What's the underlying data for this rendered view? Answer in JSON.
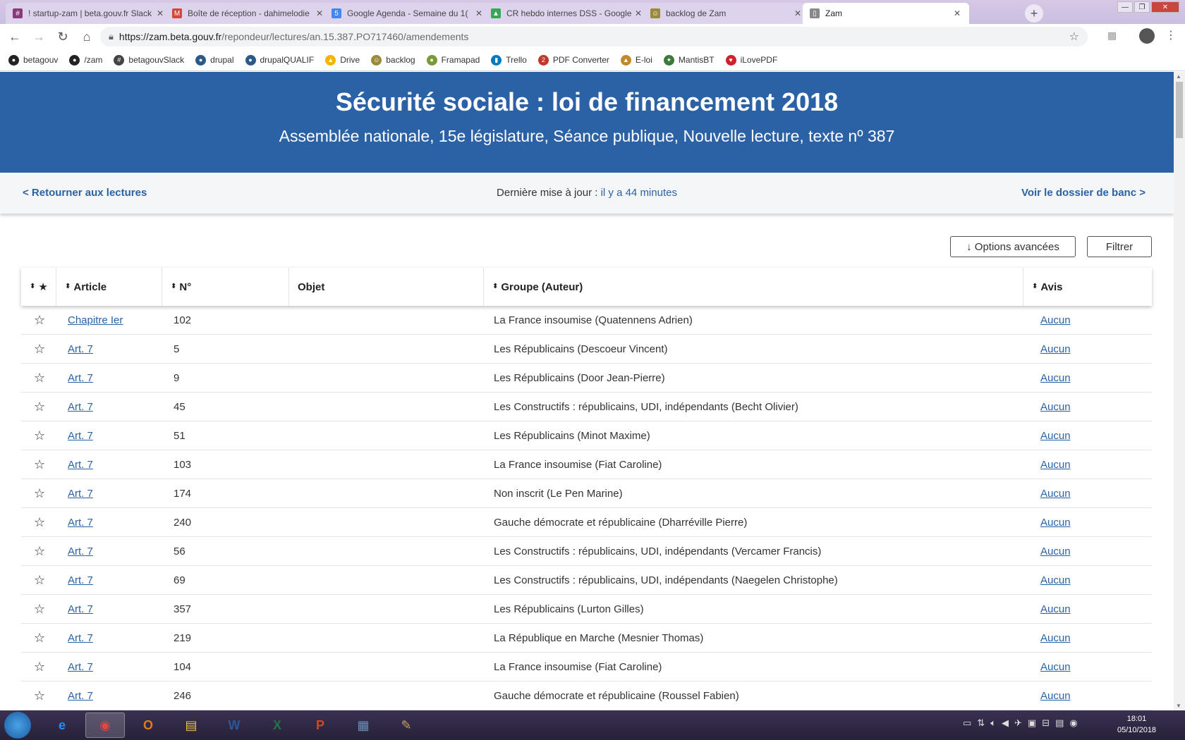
{
  "browser": {
    "tabs": [
      {
        "title": "! startup-zam | beta.gouv.fr Slack",
        "icon": "slack-icon",
        "color": "#8a3a7a",
        "glyph": "#"
      },
      {
        "title": "Boîte de réception - dahimelodie",
        "icon": "gmail-icon",
        "color": "#d44638",
        "glyph": "M"
      },
      {
        "title": "Google Agenda - Semaine du 1(",
        "icon": "calendar-icon",
        "color": "#4285f4",
        "glyph": "5"
      },
      {
        "title": "CR hebdo internes DSS - Google",
        "icon": "drive-icon",
        "color": "#34a853",
        "glyph": "▲"
      },
      {
        "title": "backlog de Zam",
        "icon": "framaboard-icon",
        "color": "#9a8a3a",
        "glyph": "☺"
      },
      {
        "title": "Zam",
        "icon": "page-icon",
        "color": "#888888",
        "glyph": "▯"
      }
    ],
    "url_host": "https://zam.beta.gouv.fr",
    "url_path": "/repondeur/lectures/an.15.387.PO717460/amendements",
    "bookmarks": [
      {
        "label": "betagouv",
        "color": "#222222",
        "glyph": "●"
      },
      {
        "label": "/zam",
        "color": "#222222",
        "glyph": "●"
      },
      {
        "label": "betagouvSlack",
        "color": "#444444",
        "glyph": "#"
      },
      {
        "label": "drupal",
        "color": "#2b5a8a",
        "glyph": "●"
      },
      {
        "label": "drupalQUALIF",
        "color": "#2b5a8a",
        "glyph": "●"
      },
      {
        "label": "Drive",
        "color": "#f4b400",
        "glyph": "▲"
      },
      {
        "label": "backlog",
        "color": "#9a8a3a",
        "glyph": "☺"
      },
      {
        "label": "Framapad",
        "color": "#7a9a3a",
        "glyph": "●"
      },
      {
        "label": "Trello",
        "color": "#0079bf",
        "glyph": "▮"
      },
      {
        "label": "PDF Converter",
        "color": "#c0392b",
        "glyph": "2"
      },
      {
        "label": "E-loi",
        "color": "#c08a2a",
        "glyph": "▲"
      },
      {
        "label": "MantisBT",
        "color": "#3a7a3a",
        "glyph": "✦"
      },
      {
        "label": "iLovePDF",
        "color": "#d0202a",
        "glyph": "♥"
      }
    ]
  },
  "page": {
    "title": "Sécurité sociale : loi de financement 2018",
    "subtitle": "Assemblée nationale, 15e législature, Séance publique, Nouvelle lecture, texte nº 387",
    "back_link": "< Retourner aux lectures",
    "last_update_label": "Dernière mise à jour :",
    "last_update_value": "il y a 44 minutes",
    "dossier_link": "Voir le dossier de banc >",
    "options_button": "↓ Options avancées",
    "filter_button": "Filtrer"
  },
  "table": {
    "headers": {
      "star": "★",
      "article": "Article",
      "numero": "N°",
      "objet": "Objet",
      "groupe": "Groupe (Auteur)",
      "avis": "Avis"
    },
    "rows": [
      {
        "article": "Chapitre Ier",
        "num": "102",
        "groupe": "La France insoumise (Quatennens Adrien)",
        "avis": "Aucun"
      },
      {
        "article": "Art. 7",
        "num": "5",
        "groupe": "Les Républicains (Descoeur Vincent)",
        "avis": "Aucun"
      },
      {
        "article": "Art. 7",
        "num": "9",
        "groupe": "Les Républicains (Door Jean-Pierre)",
        "avis": "Aucun"
      },
      {
        "article": "Art. 7",
        "num": "45",
        "groupe": "Les Constructifs : républicains, UDI, indépendants (Becht Olivier)",
        "avis": "Aucun"
      },
      {
        "article": "Art. 7",
        "num": "51",
        "groupe": "Les Républicains (Minot Maxime)",
        "avis": "Aucun"
      },
      {
        "article": "Art. 7",
        "num": "103",
        "groupe": "La France insoumise (Fiat Caroline)",
        "avis": "Aucun"
      },
      {
        "article": "Art. 7",
        "num": "174",
        "groupe": "Non inscrit (Le Pen Marine)",
        "avis": "Aucun"
      },
      {
        "article": "Art. 7",
        "num": "240",
        "groupe": "Gauche démocrate et républicaine (Dharréville Pierre)",
        "avis": "Aucun"
      },
      {
        "article": "Art. 7",
        "num": "56",
        "groupe": "Les Constructifs : républicains, UDI, indépendants (Vercamer Francis)",
        "avis": "Aucun"
      },
      {
        "article": "Art. 7",
        "num": "69",
        "groupe": "Les Constructifs : républicains, UDI, indépendants (Naegelen Christophe)",
        "avis": "Aucun"
      },
      {
        "article": "Art. 7",
        "num": "357",
        "groupe": "Les Républicains (Lurton Gilles)",
        "avis": "Aucun"
      },
      {
        "article": "Art. 7",
        "num": "219",
        "groupe": "La République en Marche (Mesnier Thomas)",
        "avis": "Aucun"
      },
      {
        "article": "Art. 7",
        "num": "104",
        "groupe": "La France insoumise (Fiat Caroline)",
        "avis": "Aucun"
      },
      {
        "article": "Art. 7",
        "num": "246",
        "groupe": "Gauche démocrate et républicaine (Roussel Fabien)",
        "avis": "Aucun"
      }
    ]
  },
  "taskbar": {
    "apps": [
      {
        "name": "internet-explorer",
        "glyph": "e",
        "color": "#1e90ff",
        "open": false
      },
      {
        "name": "chrome",
        "glyph": "◉",
        "color": "#e8453c",
        "open": true
      },
      {
        "name": "outlook",
        "glyph": "O",
        "color": "#e07a1f",
        "open": false
      },
      {
        "name": "file-explorer",
        "glyph": "▤",
        "color": "#e8c34a",
        "open": false
      },
      {
        "name": "word",
        "glyph": "W",
        "color": "#2b579a",
        "open": false
      },
      {
        "name": "excel",
        "glyph": "X",
        "color": "#217346",
        "open": false
      },
      {
        "name": "powerpoint",
        "glyph": "P",
        "color": "#d24726",
        "open": false
      },
      {
        "name": "calculator",
        "glyph": "▦",
        "color": "#6a8fbf",
        "open": false
      },
      {
        "name": "paint",
        "glyph": "✎",
        "color": "#c8a060",
        "open": false
      }
    ],
    "time": "18:01",
    "date": "05/10/2018"
  }
}
